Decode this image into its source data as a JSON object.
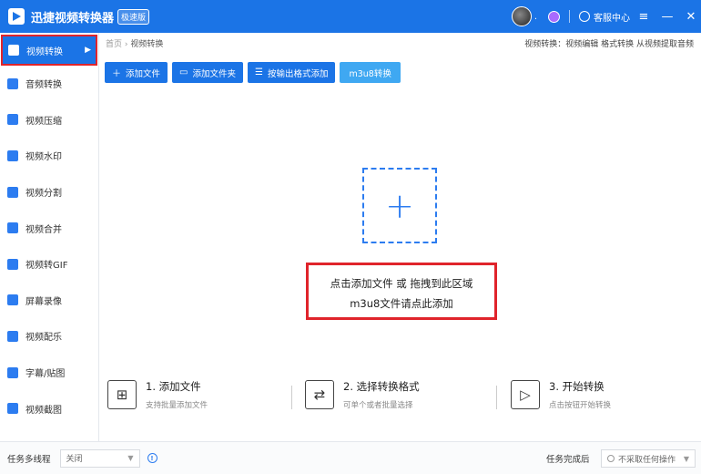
{
  "app": {
    "title": "迅捷视频转换器",
    "edition": "极速版",
    "user_suffix": ".",
    "support": "客服中心",
    "window_controls": [
      "≡",
      "—",
      "✕"
    ]
  },
  "sidebar": {
    "items": [
      {
        "label": "视频转换",
        "icon": "video-convert-icon",
        "active": true
      },
      {
        "label": "音频转换",
        "icon": "audio-convert-icon"
      },
      {
        "label": "视频压缩",
        "icon": "video-compress-icon"
      },
      {
        "label": "视频水印",
        "icon": "watermark-icon"
      },
      {
        "label": "视频分割",
        "icon": "split-icon"
      },
      {
        "label": "视频合并",
        "icon": "merge-icon"
      },
      {
        "label": "视频转GIF",
        "icon": "gif-icon"
      },
      {
        "label": "屏幕录像",
        "icon": "screen-record-icon"
      },
      {
        "label": "视频配乐",
        "icon": "music-icon"
      },
      {
        "label": "字幕/贴图",
        "icon": "subtitle-icon"
      },
      {
        "label": "视频截图",
        "icon": "screenshot-icon"
      }
    ]
  },
  "breadcrumb": {
    "home": "首页",
    "sep": "›",
    "current": "视频转换"
  },
  "quick_links": "视频转换：视频编辑 格式转换 从视频提取音频",
  "toolbar": {
    "add_file": "添加文件",
    "add_folder": "添加文件夹",
    "by_format": "按输出格式添加",
    "m3u8": "m3u8转换"
  },
  "dropzone": {
    "line1": "点击添加文件 或 拖拽到此区域",
    "line2": "m3u8文件请点此添加"
  },
  "steps": [
    {
      "title": "1. 添加文件",
      "desc": "支持批量添加文件"
    },
    {
      "title": "2. 选择转换格式",
      "desc": "可单个或者批量选择"
    },
    {
      "title": "3. 开始转换",
      "desc": "点击按钮开始转换"
    }
  ],
  "status": {
    "thread_label": "任务多线程",
    "thread_value": "关闭",
    "after_label": "任务完成后",
    "after_value": "不采取任何操作"
  },
  "colors": {
    "accent": "#1b74e6",
    "highlight": "#e0242b"
  }
}
